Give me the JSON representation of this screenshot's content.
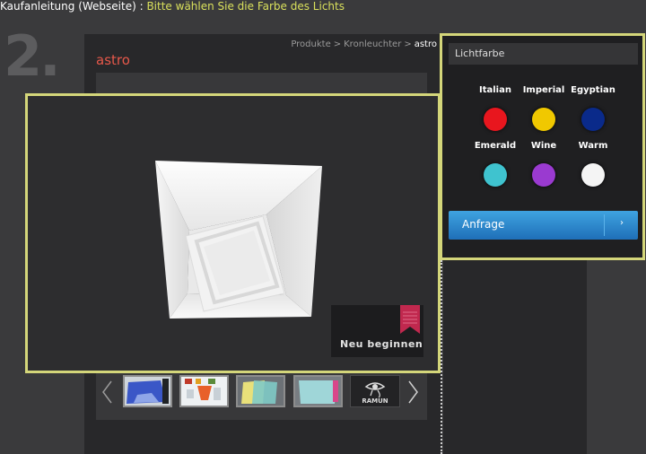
{
  "header": {
    "guide_label": "Kaufanleitung (Webseite)",
    "separator": " : ",
    "instruction": "Bitte wählen Sie die Farbe des Lichts"
  },
  "step": {
    "number": "2."
  },
  "breadcrumb": {
    "items": [
      "Produkte",
      "Kronleuchter",
      "astro"
    ],
    "separator": ">"
  },
  "product": {
    "name": "astro"
  },
  "viewer": {
    "restart_label": "Neu beginnen"
  },
  "thumbnails": {
    "brand_label": "RAMUN",
    "items": [
      "thumbnail-1",
      "thumbnail-2",
      "thumbnail-3",
      "thumbnail-4"
    ]
  },
  "color_panel": {
    "title": "Lichtfarbe",
    "colors": [
      {
        "name": "Italian",
        "hex": "#e8161e"
      },
      {
        "name": "Imperial",
        "hex": "#f0c800"
      },
      {
        "name": "Egyptian",
        "hex": "#0a2a8a"
      },
      {
        "name": "Emerald",
        "hex": "#3fc3cf"
      },
      {
        "name": "Wine",
        "hex": "#9a3ad0"
      },
      {
        "name": "Warm",
        "hex": "#f4f4f4"
      }
    ],
    "inquiry_label": "Anfrage"
  },
  "theme": {
    "accent_yellow": "#d4d67a",
    "product_name_color": "#e6584a",
    "button_blue": "#2a88cc"
  }
}
